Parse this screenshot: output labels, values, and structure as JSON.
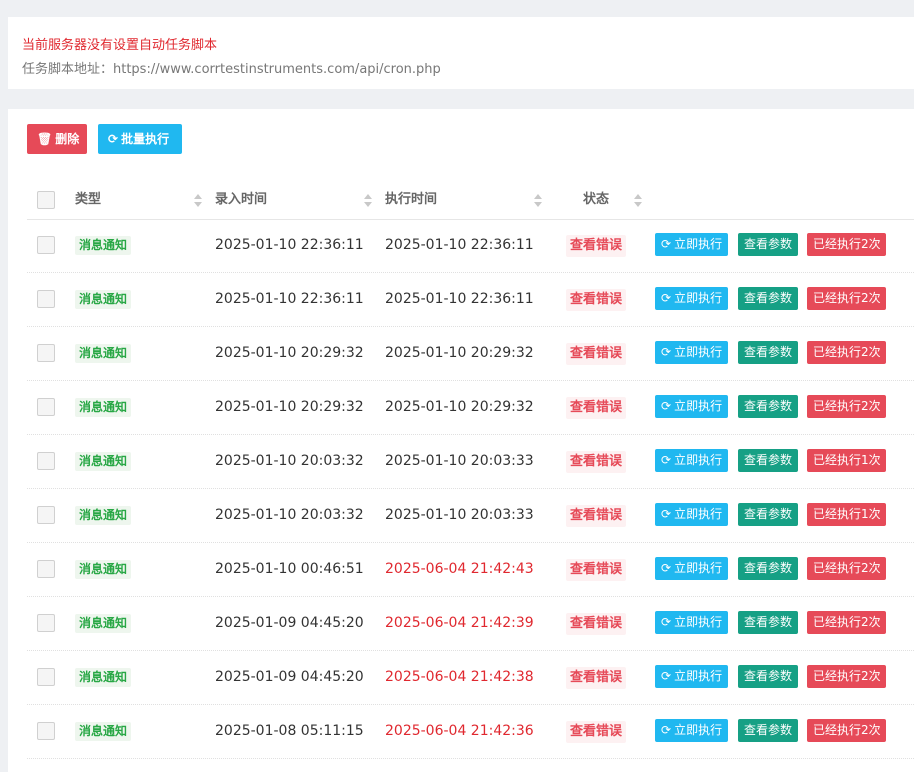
{
  "notice": {
    "warning": "当前服务器没有设置自动任务脚本",
    "address": "任务脚本地址：https://www.corrtestinstruments.com/api/cron.php"
  },
  "toolbar": {
    "delete_label": "删除",
    "batch_label": "批量执行"
  },
  "columns": {
    "type": "类型",
    "created": "录入时间",
    "executed": "执行时间",
    "status": "状态"
  },
  "colors": {
    "error_red": "#e0282f",
    "run_blue": "#20b8f0",
    "param_green": "#16a085",
    "done_red": "#e64a58",
    "type_green": "#28a745"
  },
  "rows": [
    {
      "type": "消息通知",
      "created": "2025-01-10 22:36:11",
      "executed": "2025-01-10 22:36:11",
      "executed_late": false,
      "status": "查看错误",
      "run": "立即执行",
      "params": "查看参数",
      "done": "已经执行2次"
    },
    {
      "type": "消息通知",
      "created": "2025-01-10 22:36:11",
      "executed": "2025-01-10 22:36:11",
      "executed_late": false,
      "status": "查看错误",
      "run": "立即执行",
      "params": "查看参数",
      "done": "已经执行2次"
    },
    {
      "type": "消息通知",
      "created": "2025-01-10 20:29:32",
      "executed": "2025-01-10 20:29:32",
      "executed_late": false,
      "status": "查看错误",
      "run": "立即执行",
      "params": "查看参数",
      "done": "已经执行2次"
    },
    {
      "type": "消息通知",
      "created": "2025-01-10 20:29:32",
      "executed": "2025-01-10 20:29:32",
      "executed_late": false,
      "status": "查看错误",
      "run": "立即执行",
      "params": "查看参数",
      "done": "已经执行2次"
    },
    {
      "type": "消息通知",
      "created": "2025-01-10 20:03:32",
      "executed": "2025-01-10 20:03:33",
      "executed_late": false,
      "status": "查看错误",
      "run": "立即执行",
      "params": "查看参数",
      "done": "已经执行1次"
    },
    {
      "type": "消息通知",
      "created": "2025-01-10 20:03:32",
      "executed": "2025-01-10 20:03:33",
      "executed_late": false,
      "status": "查看错误",
      "run": "立即执行",
      "params": "查看参数",
      "done": "已经执行1次"
    },
    {
      "type": "消息通知",
      "created": "2025-01-10 00:46:51",
      "executed": "2025-06-04 21:42:43",
      "executed_late": true,
      "status": "查看错误",
      "run": "立即执行",
      "params": "查看参数",
      "done": "已经执行2次"
    },
    {
      "type": "消息通知",
      "created": "2025-01-09 04:45:20",
      "executed": "2025-06-04 21:42:39",
      "executed_late": true,
      "status": "查看错误",
      "run": "立即执行",
      "params": "查看参数",
      "done": "已经执行2次"
    },
    {
      "type": "消息通知",
      "created": "2025-01-09 04:45:20",
      "executed": "2025-06-04 21:42:38",
      "executed_late": true,
      "status": "查看错误",
      "run": "立即执行",
      "params": "查看参数",
      "done": "已经执行2次"
    },
    {
      "type": "消息通知",
      "created": "2025-01-08 05:11:15",
      "executed": "2025-06-04 21:42:36",
      "executed_late": true,
      "status": "查看错误",
      "run": "立即执行",
      "params": "查看参数",
      "done": "已经执行2次"
    }
  ]
}
